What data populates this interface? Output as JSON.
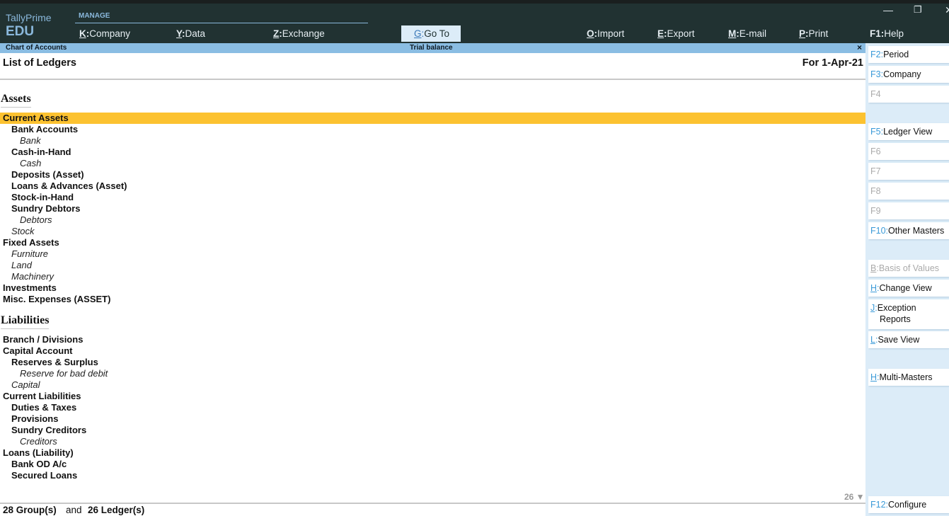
{
  "app": {
    "brand_line1": "TallyPrime",
    "brand_line2": "EDU",
    "manage_label": "MANAGE"
  },
  "window_controls": {
    "minimize": "—",
    "restore": "❐",
    "close": "✕"
  },
  "top_menu": [
    {
      "key": "K",
      "label": "Company"
    },
    {
      "key": "Y",
      "label": "Data"
    },
    {
      "key": "Z",
      "label": "Exchange"
    },
    {
      "key": "G",
      "label": "Go To"
    },
    {
      "key": "O",
      "label": "Import"
    },
    {
      "key": "E",
      "label": "Export"
    },
    {
      "key": "M",
      "label": "E-mail"
    },
    {
      "key": "P",
      "label": "Print"
    },
    {
      "key": "F1",
      "label": "Help"
    }
  ],
  "subbar": {
    "left": "Chart of Accounts",
    "center": "Trial balance",
    "close": "×"
  },
  "report": {
    "title": "List of Ledgers",
    "date": "For 1-Apr-21"
  },
  "sections": {
    "assets": "Assets",
    "liabilities": "Liabilities"
  },
  "rows": [
    {
      "label": "Current Assets",
      "type": "group",
      "level": 0,
      "selected": true
    },
    {
      "label": "Bank Accounts",
      "type": "group",
      "level": 1
    },
    {
      "label": "Bank",
      "type": "ledger",
      "level": 2
    },
    {
      "label": "Cash-in-Hand",
      "type": "group",
      "level": 1
    },
    {
      "label": "Cash",
      "type": "ledger",
      "level": 2
    },
    {
      "label": "Deposits (Asset)",
      "type": "group",
      "level": 1
    },
    {
      "label": "Loans & Advances (Asset)",
      "type": "group",
      "level": 1
    },
    {
      "label": "Stock-in-Hand",
      "type": "group",
      "level": 1
    },
    {
      "label": "Sundry Debtors",
      "type": "group",
      "level": 1
    },
    {
      "label": "Debtors",
      "type": "ledger",
      "level": 2
    },
    {
      "label": "Stock",
      "type": "ledger",
      "level": 1
    },
    {
      "label": "Fixed Assets",
      "type": "group",
      "level": 0
    },
    {
      "label": "Furniture",
      "type": "ledger",
      "level": 1
    },
    {
      "label": "Land",
      "type": "ledger",
      "level": 1
    },
    {
      "label": "Machinery",
      "type": "ledger",
      "level": 1
    },
    {
      "label": "Investments",
      "type": "group",
      "level": 0
    },
    {
      "label": "Misc. Expenses (ASSET)",
      "type": "group",
      "level": 0
    },
    {
      "label": "Branch / Divisions",
      "type": "group",
      "level": 0
    },
    {
      "label": "Capital Account",
      "type": "group",
      "level": 0
    },
    {
      "label": "Reserves & Surplus",
      "type": "group",
      "level": 1
    },
    {
      "label": "Reserve for bad debit",
      "type": "ledger",
      "level": 2
    },
    {
      "label": "Capital",
      "type": "ledger",
      "level": 1
    },
    {
      "label": "Current Liabilities",
      "type": "group",
      "level": 0
    },
    {
      "label": "Duties & Taxes",
      "type": "group",
      "level": 1
    },
    {
      "label": "Provisions",
      "type": "group",
      "level": 1
    },
    {
      "label": "Sundry Creditors",
      "type": "group",
      "level": 1
    },
    {
      "label": "Creditors",
      "type": "ledger",
      "level": 2
    },
    {
      "label": "Loans (Liability)",
      "type": "group",
      "level": 0
    },
    {
      "label": "Bank OD A/c",
      "type": "group",
      "level": 1
    },
    {
      "label": "Secured Loans",
      "type": "group",
      "level": 1
    }
  ],
  "footer": {
    "groups": "28 Group(s)",
    "and": "and",
    "ledgers": "26 Ledger(s)",
    "page_count": "26 ▼"
  },
  "sidebar": [
    {
      "key": "F2:",
      "label": "Period",
      "enabled": true
    },
    {
      "key": "F3:",
      "label": "Company",
      "enabled": true
    },
    {
      "key": "F4",
      "label": "",
      "enabled": false
    },
    {
      "key": "F5:",
      "label": "Ledger View",
      "enabled": true
    },
    {
      "key": "F6",
      "label": "",
      "enabled": false
    },
    {
      "key": "F7",
      "label": "",
      "enabled": false
    },
    {
      "key": "F8",
      "label": "",
      "enabled": false
    },
    {
      "key": "F9",
      "label": "",
      "enabled": false
    },
    {
      "key": "F10:",
      "label": "Other Masters",
      "enabled": true
    },
    {
      "key": "B",
      "label": "Basis of Values",
      "enabled": false
    },
    {
      "key": "H",
      "label": "Change View",
      "enabled": true
    },
    {
      "key": "J",
      "label": "Exception",
      "label2": "Reports",
      "enabled": true
    },
    {
      "key": "L",
      "label": "Save View",
      "enabled": true
    },
    {
      "key": "H",
      "label": "Multi-Masters",
      "enabled": true
    },
    {
      "key": "F12:",
      "label": "Configure",
      "enabled": true
    }
  ],
  "colors": {
    "topbar": "#213232",
    "accent": "#8ab8dc",
    "subbar": "#8abde3",
    "selection": "#fcc230",
    "sidebar": "#dcecf8",
    "key_blue": "#3a9ad8"
  }
}
